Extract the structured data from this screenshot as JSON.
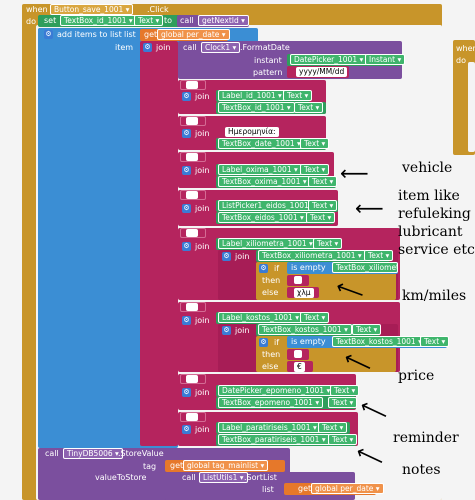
{
  "event": {
    "when": "when",
    "component": "Button_save_1001",
    "event_name": ".Click",
    "do": "do"
  },
  "set_block": {
    "set": "set",
    "component": "TextBox_id_1001",
    "property": "Text",
    "to": "to",
    "call": "call",
    "procedure": "getNextId"
  },
  "add_items": {
    "label": "add items to list",
    "list_label": "list",
    "get": "get",
    "list_var": "global per_date",
    "item_label": "item"
  },
  "join_label": "join",
  "format_date": {
    "call": "call",
    "component": "Clock1",
    "method": ".FormatDate",
    "instant_label": "instant",
    "instant_component": "DatePicker_1001",
    "instant_property": "Instant",
    "pattern_label": "pattern",
    "pattern_value": "yyyy/MM/dd"
  },
  "rows": [
    {
      "label": "Label_id_1001",
      "textbox": "TextBox_id_1001",
      "prop": "Text"
    },
    {
      "text": "Ημερομηνία:",
      "textbox": "TextBox_date_1001",
      "prop": "Text"
    },
    {
      "label": "Label_oxima_1001",
      "textbox": "TextBox_oxima_1001",
      "prop": "Text"
    },
    {
      "label": "ListPicker1_eidos_1001",
      "textbox": "TextBox_eidos_1001",
      "prop": "Text"
    },
    {
      "label": "Label_xiliometra_1001",
      "textbox": "TextBox_xiliometra_1001",
      "prop": "Text"
    },
    {
      "label": "Label_kostos_1001",
      "textbox": "TextBox_kostos_1001",
      "prop": "Text"
    },
    {
      "label": "DatePicker_epomeno_1001",
      "textbox": "TextBox_epomeno_1001",
      "prop": "Text"
    },
    {
      "label": "Label_paratiriseis_1001",
      "textbox": "TextBox_paratiriseis_1001",
      "prop": "Text"
    }
  ],
  "if_block": {
    "if": "if",
    "is_empty": "is empty",
    "then": "then",
    "else": "else",
    "km_value": "χλμ",
    "euro_value": "€"
  },
  "store": {
    "call": "call",
    "component": "TinyDB5006",
    "method": ".StoreValue",
    "tag_label": "tag",
    "get": "get",
    "tag_var": "global tag_mainlist",
    "value_label": "valueToStore",
    "call2": "call",
    "sort_component": "ListUtils1",
    "sort_method": ".SortList",
    "list_label": "list",
    "list_var": "global per_date"
  },
  "side_block": {
    "when": "when",
    "do": "do"
  },
  "annotations": {
    "vehicle": "vehicle",
    "item_line1": "item  like",
    "item_line2": "refuleking",
    "item_line3": "lubricant",
    "item_line4": "service  etc",
    "km": "km/miles",
    "price": "price",
    "reminder": "reminder",
    "notes": "notes"
  }
}
